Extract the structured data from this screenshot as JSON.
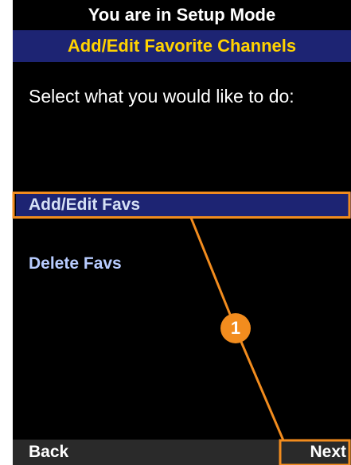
{
  "header": {
    "mode_text": "You are in Setup Mode",
    "title": "Add/Edit Favorite Channels"
  },
  "prompt": "Select what you would like to do:",
  "menu": {
    "items": [
      {
        "label": "Add/Edit Favs",
        "selected": true
      },
      {
        "label": "Delete Favs",
        "selected": false
      }
    ]
  },
  "softkeys": {
    "left": "Back",
    "right": "Next"
  },
  "callout": {
    "number": "1",
    "color": "#f28c1e"
  },
  "colors": {
    "screen_bg": "#000000",
    "title_bg": "#1d2473",
    "title_text": "#ffd200",
    "highlight_bg": "#1d2473",
    "menu_text": "#b8ccff"
  }
}
